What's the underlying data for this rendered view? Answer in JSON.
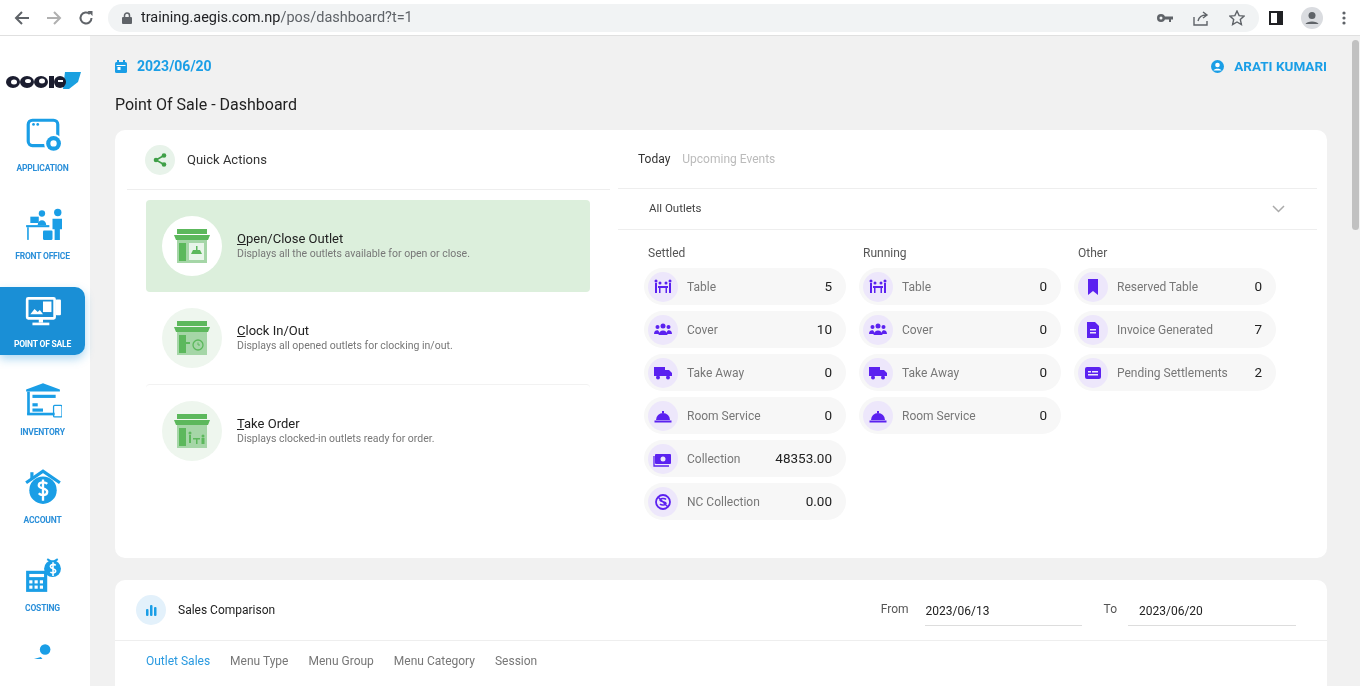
{
  "browser": {
    "url_host": "training.aegis.com.np",
    "url_path": "/pos/dashboard?t=1"
  },
  "sidebar": {
    "items": [
      {
        "label": "APPLICATION",
        "kind": "application",
        "selected": false
      },
      {
        "label": "FRONT OFFICE",
        "kind": "front_office",
        "selected": false
      },
      {
        "label": "POINT OF SALE",
        "kind": "pos",
        "selected": true
      },
      {
        "label": "INVENTORY",
        "kind": "inventory",
        "selected": false
      },
      {
        "label": "ACCOUNT",
        "kind": "account",
        "selected": false
      },
      {
        "label": "COSTING",
        "kind": "costing",
        "selected": false
      },
      {
        "kind": "person",
        "selected": false
      }
    ]
  },
  "header": {
    "date": "2023/06/20",
    "user": "ARATI KUMARI",
    "page_title": "Point Of Sale - Dashboard"
  },
  "quick_actions": {
    "title": "Quick Actions",
    "items": [
      {
        "title": "Open/Close Outlet",
        "description": "Displays all the outlets available for open or close.",
        "kind": "open",
        "selected": true
      },
      {
        "title": "Clock In/Out",
        "description": "Displays all opened outlets for clocking in/out.",
        "kind": "clock",
        "selected": false
      },
      {
        "title": "Take Order",
        "description": "Displays clocked-in outlets ready for order.",
        "kind": "order",
        "selected": false
      }
    ]
  },
  "overview": {
    "tabs": [
      {
        "label": "Today",
        "selected": true
      },
      {
        "label": "Upcoming Events",
        "selected": false
      }
    ],
    "outlet_select": {
      "value": "All Outlets"
    },
    "groups": [
      {
        "title": "Settled",
        "stats": [
          {
            "label": "Table",
            "value": "5",
            "kind": "table"
          },
          {
            "label": "Cover",
            "value": "10",
            "kind": "cover"
          },
          {
            "label": "Take Away",
            "value": "0",
            "kind": "truck"
          },
          {
            "label": "Room Service",
            "value": "0",
            "kind": "bell"
          },
          {
            "label": "Collection",
            "value": "48353.00",
            "kind": "money"
          },
          {
            "label": "NC Collection",
            "value": "0.00",
            "kind": "nc"
          }
        ]
      },
      {
        "title": "Running",
        "stats": [
          {
            "label": "Table",
            "value": "0",
            "kind": "table"
          },
          {
            "label": "Cover",
            "value": "0",
            "kind": "cover"
          },
          {
            "label": "Take Away",
            "value": "0",
            "kind": "truck"
          },
          {
            "label": "Room Service",
            "value": "0",
            "kind": "bell"
          }
        ]
      },
      {
        "title": "Other",
        "stats": [
          {
            "label": "Reserved Table",
            "value": "0",
            "kind": "bookmark"
          },
          {
            "label": "Invoice Generated",
            "value": "7",
            "kind": "invoice"
          },
          {
            "label": "Pending Settlements",
            "value": "2",
            "kind": "card"
          }
        ]
      }
    ]
  },
  "sales_comparison": {
    "title": "Sales Comparison",
    "from_label": "From",
    "from": "2023/06/13",
    "to_label": "To",
    "to": "2023/06/20",
    "tabs": [
      {
        "label": "Outlet Sales",
        "selected": true
      },
      {
        "label": "Menu Type",
        "selected": false
      },
      {
        "label": "Menu Group",
        "selected": false
      },
      {
        "label": "Menu Category",
        "selected": false
      },
      {
        "label": "Session",
        "selected": false
      }
    ]
  }
}
